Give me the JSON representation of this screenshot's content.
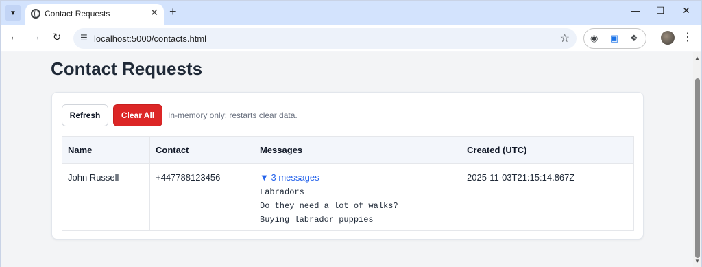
{
  "browser": {
    "tab_title": "Contact Requests",
    "url": "localhost:5000/contacts.html",
    "icons": {
      "tab_menu": "chevron-down-icon",
      "favicon": "globe-icon",
      "close": "close-icon",
      "new_tab": "plus-icon",
      "back": "arrow-left-icon",
      "forward": "arrow-right-icon",
      "reload": "reload-icon",
      "site_info": "tune-icon",
      "bookmark": "star-icon",
      "screenshot": "camera-icon",
      "record": "record-icon",
      "extensions": "puzzle-icon",
      "profile": "avatar",
      "menu": "kebab-icon"
    }
  },
  "page": {
    "title": "Contact Requests",
    "toolbar": {
      "refresh_label": "Refresh",
      "clear_label": "Clear All",
      "note": "In-memory only; restarts clear data."
    },
    "table": {
      "headers": [
        "Name",
        "Contact",
        "Messages",
        "Created (UTC)"
      ],
      "rows": [
        {
          "name": "John Russell",
          "contact": "+447788123456",
          "messages_summary": "3 messages",
          "messages": [
            "Labradors",
            "Do they need a lot of walks?",
            "Buying labrador puppies"
          ],
          "created": "2025-11-03T21:15:14.867Z"
        }
      ]
    }
  },
  "colors": {
    "tabbar": "#d3e3fd",
    "danger": "#dc2626",
    "link": "#2563eb",
    "header_bg": "#f3f6fb"
  }
}
